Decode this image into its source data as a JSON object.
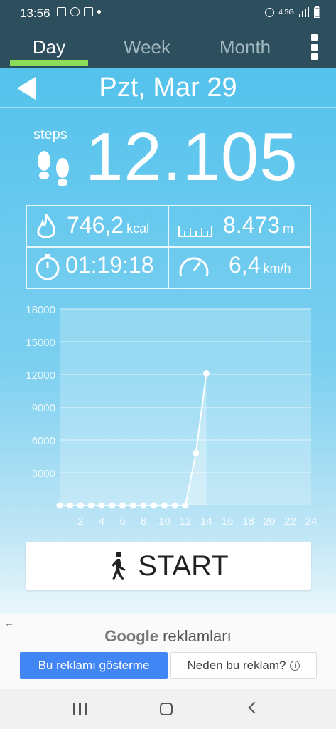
{
  "status_bar": {
    "time": "13:56",
    "network_label": "4.5G"
  },
  "tabs": [
    {
      "label": "Day",
      "active": true
    },
    {
      "label": "Week",
      "active": false
    },
    {
      "label": "Month",
      "active": false
    }
  ],
  "date": {
    "title": "Pzt, Mar 29"
  },
  "steps": {
    "label": "steps",
    "value": "12.105"
  },
  "stats": {
    "calories": {
      "value": "746,2",
      "unit": "kcal"
    },
    "distance": {
      "value": "8.473",
      "unit": "m"
    },
    "duration": {
      "value": "01:19:18"
    },
    "speed": {
      "value": "6,4",
      "unit": "km/h"
    }
  },
  "chart_data": {
    "type": "line",
    "ylim": [
      0,
      18000
    ],
    "xlim": [
      0,
      24
    ],
    "y_ticks": [
      "3000",
      "6000",
      "9000",
      "12000",
      "15000",
      "18000"
    ],
    "x_ticks": [
      "2",
      "4",
      "6",
      "8",
      "10",
      "12",
      "14",
      "16",
      "18",
      "20",
      "22",
      "24"
    ],
    "x": [
      0,
      1,
      2,
      3,
      4,
      5,
      6,
      7,
      8,
      9,
      10,
      11,
      12,
      13,
      14
    ],
    "values": [
      0,
      0,
      0,
      0,
      0,
      0,
      0,
      0,
      0,
      0,
      0,
      0,
      0,
      4800,
      12105
    ],
    "grid": true
  },
  "start_button": {
    "label": "START"
  },
  "ad": {
    "title_brand": "Google",
    "title_rest": "reklamları",
    "hide_label": "Bu reklamı gösterme",
    "why_label": "Neden bu reklam?"
  },
  "colors": {
    "header": "#2d4f5d",
    "accent_green": "#8bdc5a",
    "ad_blue": "#4285f4"
  }
}
